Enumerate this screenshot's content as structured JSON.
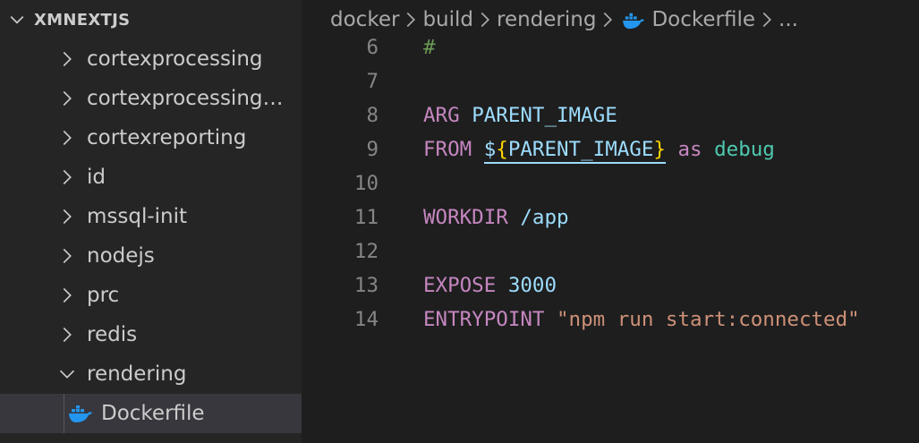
{
  "sidebar": {
    "section_title": "XMNEXTJS",
    "folders": [
      {
        "label": "cortexprocessing",
        "expanded": false
      },
      {
        "label": "cortexprocessingw...",
        "expanded": false
      },
      {
        "label": "cortexreporting",
        "expanded": false
      },
      {
        "label": "id",
        "expanded": false
      },
      {
        "label": "mssql-init",
        "expanded": false
      },
      {
        "label": "nodejs",
        "expanded": false
      },
      {
        "label": "prc",
        "expanded": false
      },
      {
        "label": "redis",
        "expanded": false
      },
      {
        "label": "rendering",
        "expanded": true
      }
    ],
    "active_file": {
      "label": "Dockerfile",
      "icon": "docker-icon"
    }
  },
  "breadcrumb": {
    "items": [
      "docker",
      "build",
      "rendering"
    ],
    "file": "Dockerfile",
    "more": "..."
  },
  "editor": {
    "lines": [
      {
        "number": "6",
        "tokens": [
          {
            "t": "#",
            "c": "cm"
          }
        ]
      },
      {
        "number": "7",
        "tokens": []
      },
      {
        "number": "8",
        "tokens": [
          {
            "t": "ARG",
            "c": "kw"
          },
          {
            "t": " ",
            "c": "plain"
          },
          {
            "t": "PARENT_IMAGE",
            "c": "var"
          }
        ]
      },
      {
        "number": "9",
        "tokens": [
          {
            "t": "FROM",
            "c": "kw"
          },
          {
            "t": " ",
            "c": "plain"
          },
          {
            "t": "$",
            "c": "var ul"
          },
          {
            "t": "{",
            "c": "brace ul"
          },
          {
            "t": "PARENT_IMAGE",
            "c": "var ul"
          },
          {
            "t": "}",
            "c": "brace ul"
          },
          {
            "t": " ",
            "c": "plain"
          },
          {
            "t": "as",
            "c": "kw"
          },
          {
            "t": " ",
            "c": "plain"
          },
          {
            "t": "debug",
            "c": "tag"
          }
        ]
      },
      {
        "number": "10",
        "tokens": []
      },
      {
        "number": "11",
        "tokens": [
          {
            "t": "WORKDIR",
            "c": "kw"
          },
          {
            "t": " ",
            "c": "plain"
          },
          {
            "t": "/app",
            "c": "var"
          }
        ]
      },
      {
        "number": "12",
        "tokens": []
      },
      {
        "number": "13",
        "tokens": [
          {
            "t": "EXPOSE",
            "c": "kw"
          },
          {
            "t": " ",
            "c": "plain"
          },
          {
            "t": "3000",
            "c": "var"
          }
        ]
      },
      {
        "number": "14",
        "tokens": [
          {
            "t": "ENTRYPOINT",
            "c": "kw"
          },
          {
            "t": " ",
            "c": "plain"
          },
          {
            "t": "\"npm run start:connected\"",
            "c": "str"
          }
        ]
      }
    ]
  },
  "colors": {
    "sidebar_bg": "#252526",
    "editor_bg": "#1e1e1e",
    "selection_bg": "#37373d",
    "docker_blue": "#2396ed"
  }
}
